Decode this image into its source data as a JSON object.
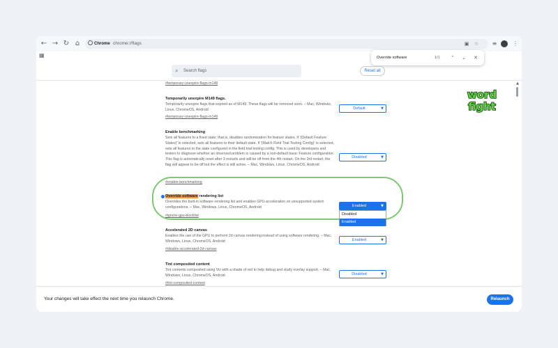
{
  "browser": {
    "back_icon": "arrow-left-icon",
    "forward_icon": "arrow-right-icon",
    "reload_icon": "reload-icon",
    "home_icon": "home-icon",
    "site_chip": "Chrome",
    "url": "chrome://flags",
    "menu_icon": "more-vertical-icon"
  },
  "find_bar": {
    "query": "Override software",
    "count": "1/1"
  },
  "header": {
    "search_placeholder": "Search flags",
    "reset_label": "Reset all"
  },
  "flags": [
    {
      "id": "temporary-unexpire-flags-m148",
      "link": "#temporary-unexpire-flags-m148"
    },
    {
      "id": "temporary-unexpire-flags-m149",
      "title": "Temporarily unexpire M149 flags.",
      "description": "Temporarily unexpire flags that expired as of M149. These flags will be removed soon. – Mac, Windows, Linux, ChromeOS, Android",
      "link": "#temporary-unexpire-flags-m149",
      "value": "Default"
    },
    {
      "id": "enable-benchmarking",
      "title": "Enable benchmarking",
      "description": "Sets all features to a fixed state; that is, disables randomization for feature states. If '(Default Feature States)' is selected, sets all features to their default state. If '(Match Field Trial Testing Config)' is selected, sets all features to the state configured in the field trial testing config. This is used by developers and testers to diagnose whether an observed problem is caused by a non-default base::Feature configuration. This flag is automatically reset after 3 restarts and will be off from the 4th restart. On the 3rd restart, the flag will appear to be off but the effect is still active. – Mac, Windows, Linux, ChromeOS, Android",
      "link": "#enable-benchmarking",
      "value": "Disabled"
    },
    {
      "id": "ignore-gpu-blocklist",
      "title_highlight": "Override software",
      "title_rest": " rendering list",
      "description": "Overrides the built-in software rendering list and enables GPU-acceleration on unsupported system configurations. – Mac, Windows, Linux, ChromeOS, Android",
      "link": "#ignore-gpu-blocklist",
      "value": "Enabled",
      "options": [
        "Disabled",
        "Enabled"
      ]
    },
    {
      "id": "disable-accelerated-2d-canvas",
      "title": "Accelerated 2D canvas",
      "description": "Enables the use of the GPU to perform 2d canvas rendering instead of using software rendering. – Mac, Windows, Linux, ChromeOS, Android",
      "link": "#disable-accelerated-2d-canvas",
      "value": "Enabled"
    },
    {
      "id": "tint-composited-content",
      "title": "Tint composited content",
      "description": "Tint contents composited using Viz with a shade of red to help debug and study overlay support. – Mac, Windows, Linux, ChromeOS, Android",
      "link": "#tint-composited-content",
      "value": "Disabled"
    }
  ],
  "bottom_bar": {
    "message": "Your changes will take effect the next time you relaunch Chrome.",
    "relaunch_label": "Relaunch"
  },
  "logo": {
    "line1": "word",
    "line2": "fight",
    "fill_color": "#5bd33c",
    "outline_color": "#163b12"
  },
  "colors": {
    "accent": "#1a73e8",
    "find_highlight": "#ff9632",
    "focus_ring": "#7bc96f"
  }
}
